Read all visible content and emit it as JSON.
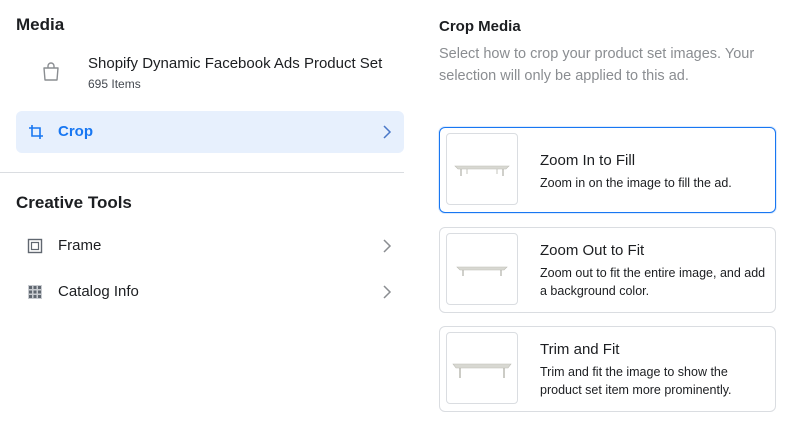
{
  "left": {
    "media_title": "Media",
    "product_set": {
      "name": "Shopify Dynamic Facebook Ads Product Set",
      "count": "695 Items",
      "icon": "shopping-bag-icon"
    },
    "crop": {
      "label": "Crop",
      "icon": "crop-icon"
    },
    "creative_tools_title": "Creative Tools",
    "tools": [
      {
        "label": "Frame",
        "icon": "frame-icon"
      },
      {
        "label": "Catalog Info",
        "icon": "catalog-grid-icon"
      }
    ]
  },
  "right": {
    "title": "Crop Media",
    "description": "Select how to crop your product set images. Your selection will only be applied to this ad.",
    "options": [
      {
        "title": "Zoom In to Fill",
        "desc": "Zoom in on the image to fill the ad.",
        "selected": true
      },
      {
        "title": "Zoom Out to Fit",
        "desc": "Zoom out to fit the entire image, and add a background color.",
        "selected": false
      },
      {
        "title": "Trim and Fit",
        "desc": "Trim and fit the image to show the product set item more prominently.",
        "selected": false
      }
    ]
  },
  "colors": {
    "accent": "#1877f2",
    "selected_bg": "#e7f0fd",
    "muted_text": "#8a8d91",
    "border": "#dadde1"
  }
}
